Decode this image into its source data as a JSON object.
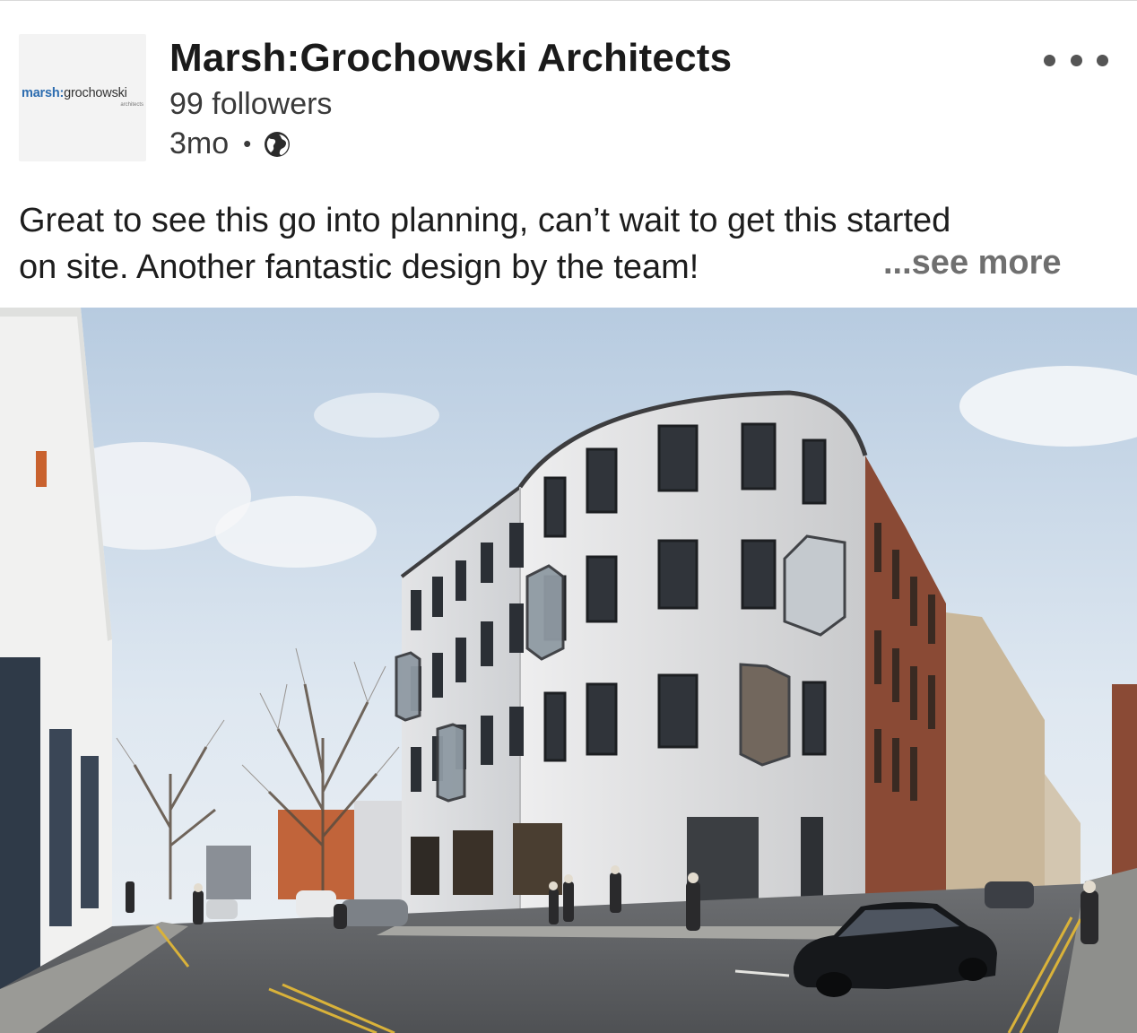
{
  "post": {
    "author": {
      "name": "Marsh:Grochowski Architects",
      "followers": "99 followers",
      "logo": {
        "part1": "marsh:",
        "part2": "grochowski",
        "sub": "architects"
      }
    },
    "timestamp": "3mo",
    "separator": "•",
    "visibility_icon": "globe-icon",
    "menu_icon": "more-options-icon",
    "text_lines": [
      "Great to see this go into planning, can’t wait to get this started",
      "on site. Another fantastic design by the team!"
    ],
    "see_more": "...see more",
    "image": {
      "description_icon": "architectural-rendering"
    }
  },
  "colors": {
    "logo_blue": "#2d6db0",
    "text": "#1d1d1d",
    "muted": "#6f6f6f"
  }
}
